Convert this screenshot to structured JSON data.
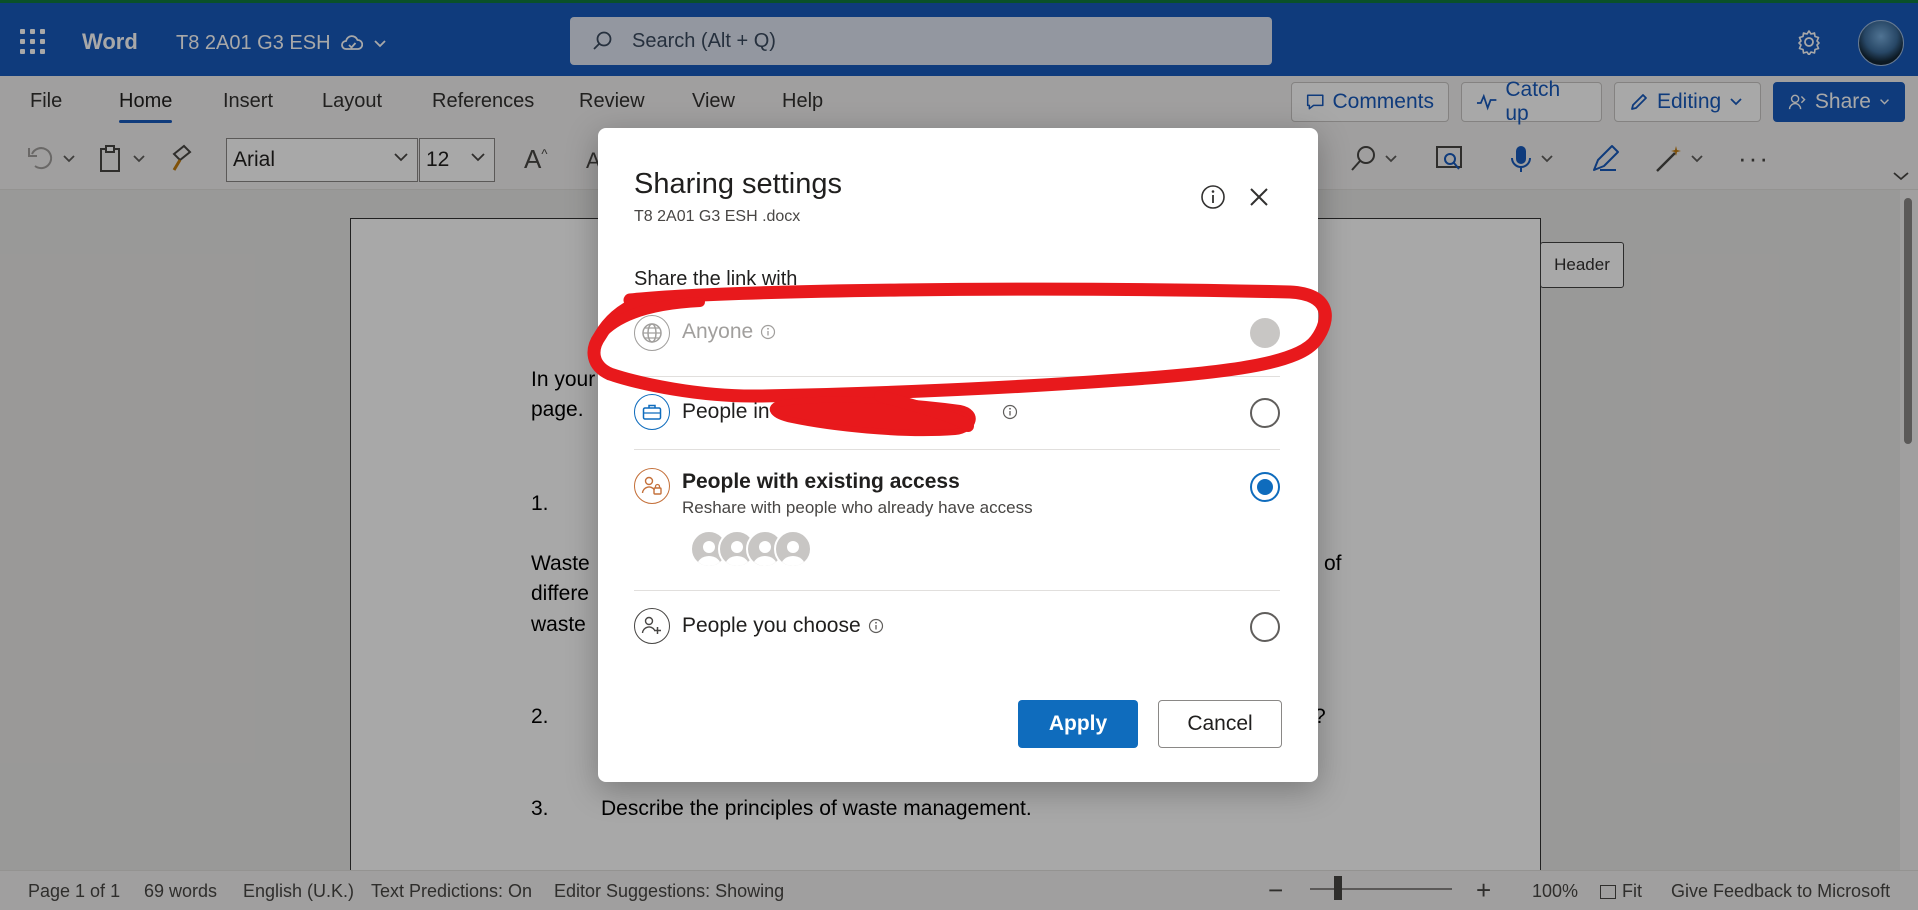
{
  "app": {
    "name": "Word",
    "doc_title": "T8 2A01 G3 ESH",
    "search_placeholder": "Search (Alt + Q)"
  },
  "ribbon": {
    "tabs": [
      "File",
      "Home",
      "Insert",
      "Layout",
      "References",
      "Review",
      "View",
      "Help"
    ],
    "active_tab": "Home",
    "buttons": {
      "comments": "Comments",
      "catch_up": "Catch up",
      "editing": "Editing",
      "share": "Share"
    }
  },
  "toolbar": {
    "font_name": "Arial",
    "font_size": "12",
    "grow_font": "A",
    "shrink_font": "A"
  },
  "document": {
    "header_tag": "Header",
    "text_lines": [
      "In your",
      "page.",
      "1.",
      "Waste",
      "differe",
      "waste",
      "of",
      "2.",
      "?",
      "3.",
      "Describe the principles of waste management."
    ]
  },
  "status": {
    "page": "Page 1 of 1",
    "words": "69 words",
    "language": "English (U.K.)",
    "text_predictions": "Text Predictions: On",
    "editor_suggestions": "Editor Suggestions: Showing",
    "zoom": "100%",
    "zoom_level": 0.2,
    "fit": "Fit",
    "feedback": "Give Feedback to Microsoft"
  },
  "dialog": {
    "title": "Sharing settings",
    "filename": "T8 2A01 G3 ESH .docx",
    "section_label": "Share the link with",
    "options": [
      {
        "label": "Anyone",
        "state": "disabled",
        "icon": "globe-icon"
      },
      {
        "label": "People in",
        "state": "unchecked",
        "icon": "briefcase-icon"
      },
      {
        "label": "People with existing access",
        "sublabel": "Reshare with people who already have access",
        "state": "checked",
        "icon": "people-lock-icon"
      },
      {
        "label": "People you choose",
        "state": "unchecked",
        "icon": "people-add-icon"
      }
    ],
    "apply_label": "Apply",
    "cancel_label": "Cancel"
  },
  "colors": {
    "title_bar": "#185abd",
    "accent": "#0f6cbd",
    "annotation": "#e8191c"
  }
}
